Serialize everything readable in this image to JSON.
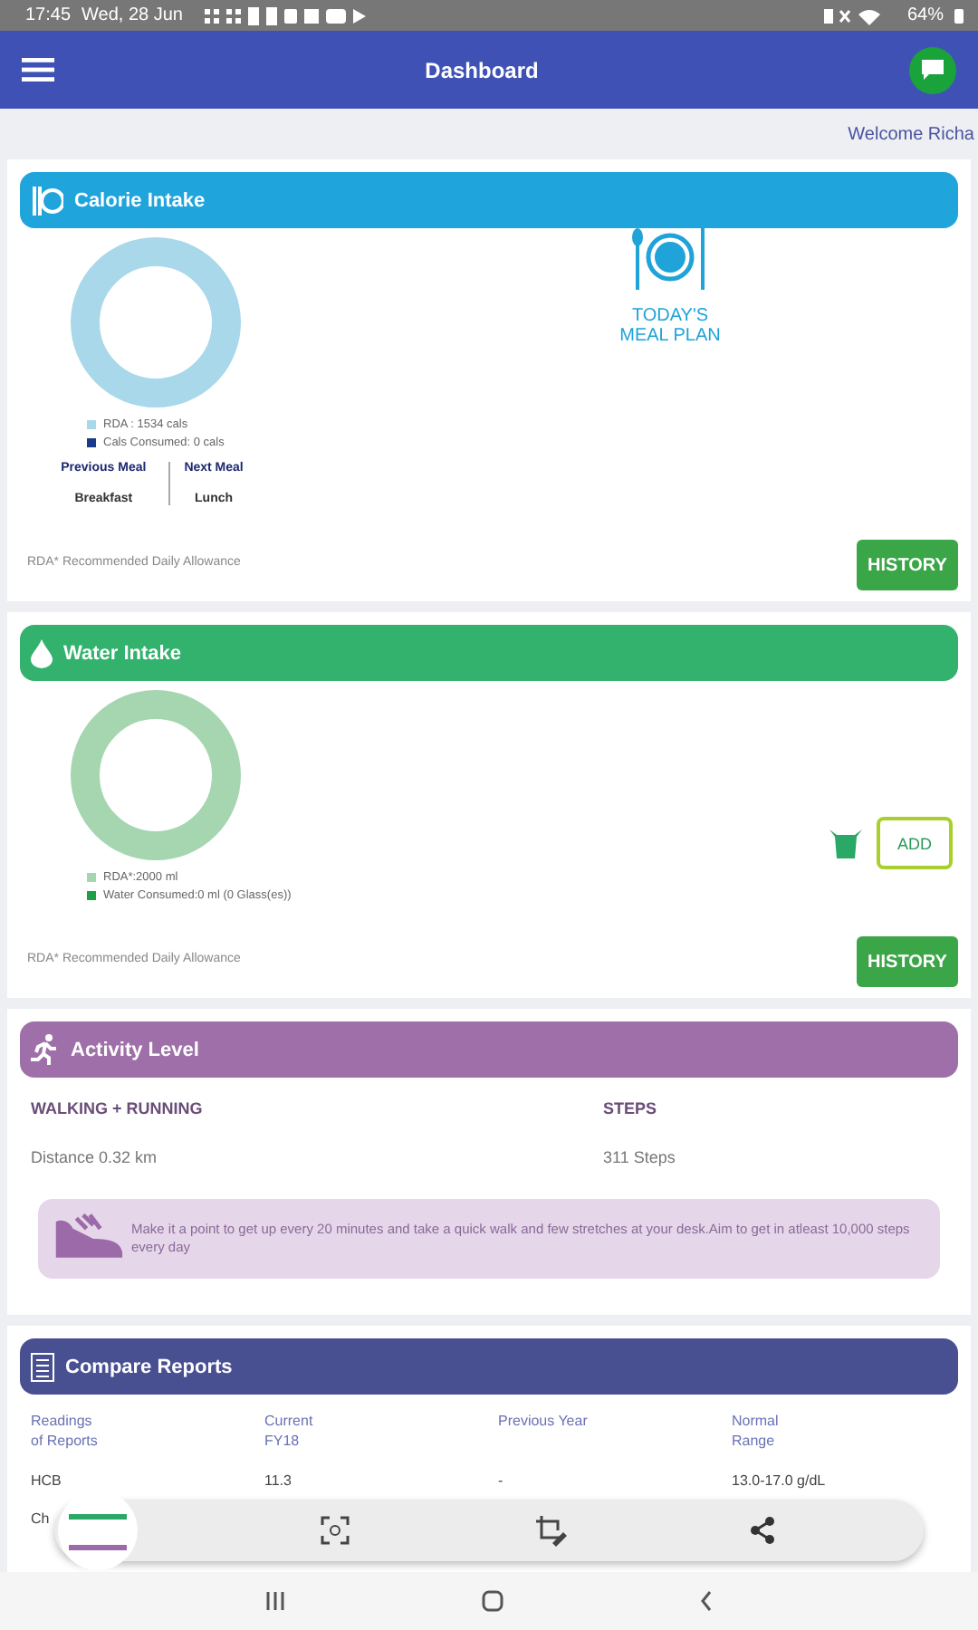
{
  "status_bar": {
    "time": "17:45",
    "date": "Wed, 28 Jun",
    "battery": "64%"
  },
  "app_bar": {
    "title": "Dashboard"
  },
  "welcome": "Welcome Richa",
  "calorie": {
    "title": "Calorie Intake",
    "legend": [
      {
        "label": "RDA : 1534 cals",
        "color": "#a8d8ea"
      },
      {
        "label": "Cals Consumed: 0 cals",
        "color": "#1a3a8a"
      }
    ],
    "meals": [
      {
        "heading": "Previous Meal",
        "value": "Breakfast"
      },
      {
        "heading": "Next Meal",
        "value": "Lunch"
      }
    ],
    "meal_plan": [
      "TODAY'S",
      "MEAL PLAN"
    ],
    "footnote": "RDA* Recommended Daily Allowance",
    "history": "HISTORY"
  },
  "water": {
    "title": "Water Intake",
    "legend": [
      {
        "label": "RDA*:2000 ml",
        "color": "#a5d6b0"
      },
      {
        "label": "Water Consumed:0 ml (0 Glass(es))",
        "color": "#1e9e45"
      }
    ],
    "add": "ADD",
    "footnote": "RDA* Recommended Daily Allowance",
    "history": "HISTORY"
  },
  "activity": {
    "title": "Activity Level",
    "columns": [
      {
        "heading": "WALKING + RUNNING",
        "value": "Distance 0.32 km"
      },
      {
        "heading": "STEPS",
        "value": "311 Steps"
      }
    ],
    "tip": "Make it a point to get up every 20 minutes and take a quick walk and few stretches at your desk.Aim to get in atleast 10,000 steps every day"
  },
  "reports": {
    "title": "Compare Reports",
    "columns": [
      "Readings\nof Reports",
      "Current\nFY18",
      "Previous Year",
      "Normal\nRange"
    ],
    "rows": [
      [
        "HCB",
        "11.3",
        "-",
        "13.0-17.0 g/dL"
      ],
      [
        "Ch"
      ]
    ]
  }
}
